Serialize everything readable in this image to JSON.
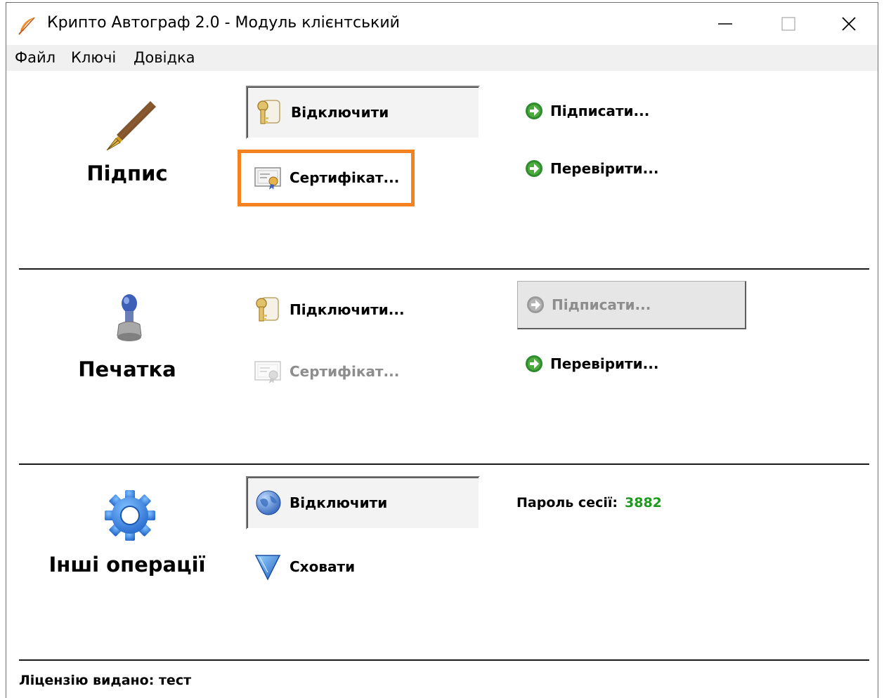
{
  "window": {
    "title": "Крипто Автограф 2.0 - Модуль клієнтський"
  },
  "menu": {
    "items": [
      "Файл",
      "Ключі",
      "Довідка"
    ]
  },
  "sections": {
    "signature": {
      "title": "Підпис",
      "connect_label": "Відключити",
      "certificate_label": "Сертифікат...",
      "sign_label": "Підписати...",
      "verify_label": "Перевірити..."
    },
    "seal": {
      "title": "Печатка",
      "connect_label": "Підключити...",
      "certificate_label": "Сертифікат...",
      "sign_label": "Підписати...",
      "verify_label": "Перевірити..."
    },
    "other": {
      "title": "Інші операції",
      "connect_label": "Відключити",
      "hide_label": "Сховати",
      "session_password_label": "Пароль сесії:",
      "session_password_value": "3882"
    }
  },
  "status": {
    "license_text": "Ліцензію видано: тест"
  },
  "colors": {
    "highlight": "#f58220",
    "accent_green": "#1e9a1e",
    "arrow_green": "#2e8b2e",
    "disabled_text": "#8d8d8d"
  }
}
